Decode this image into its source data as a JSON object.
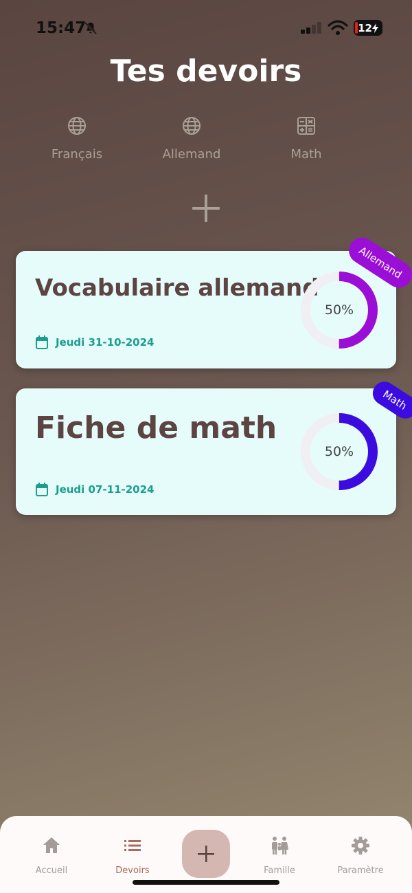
{
  "status_bar": {
    "time": "15:47",
    "battery": "12"
  },
  "page_title": "Tes devoirs",
  "subjects": [
    {
      "label": "Français",
      "icon": "globe-icon"
    },
    {
      "label": "Allemand",
      "icon": "globe-icon"
    },
    {
      "label": "Math",
      "icon": "calculator-icon"
    }
  ],
  "homework": [
    {
      "title": "Vocabulaire allemand",
      "date": "Jeudi 31-10-2024",
      "progress": 50,
      "progress_label": "50%",
      "tag": "Allemand",
      "color": "#9a0ed6"
    },
    {
      "title": "Fiche de math",
      "date": "Jeudi 07-11-2024",
      "progress": 50,
      "progress_label": "50%",
      "tag": "Math",
      "color": "#3b0be0"
    }
  ],
  "nav": {
    "home": "Accueil",
    "homework": "Devoirs",
    "family": "Famille",
    "settings": "Paramètre"
  },
  "colors": {
    "card_bg": "#e6fcfb",
    "title_text": "#5b4441",
    "date_text": "#1a9e8e",
    "fab_bg": "#d4b7b1",
    "active_nav": "#a76a5c"
  }
}
